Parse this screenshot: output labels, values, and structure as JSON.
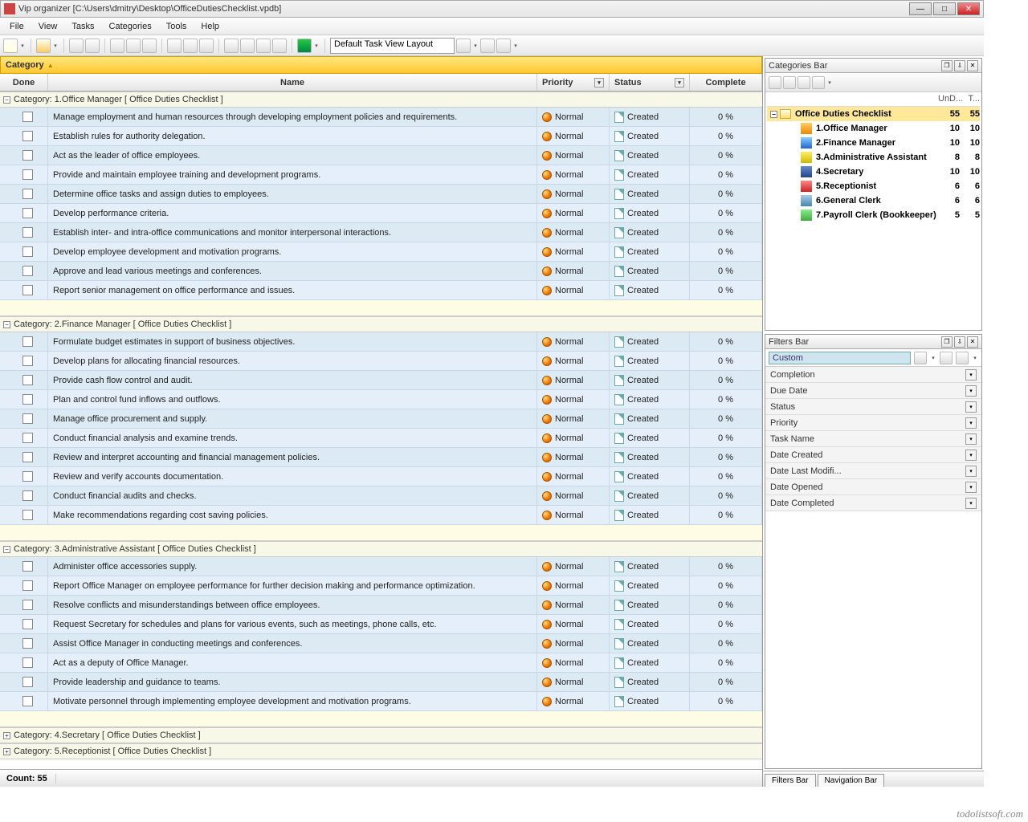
{
  "window": {
    "title": "Vip organizer [C:\\Users\\dmitry\\Desktop\\OfficeDutiesChecklist.vpdb]"
  },
  "menu": [
    "File",
    "View",
    "Tasks",
    "Categories",
    "Tools",
    "Help"
  ],
  "toolbar": {
    "layout_name": "Default Task View Layout"
  },
  "category_bar": {
    "label": "Category"
  },
  "grid": {
    "columns": {
      "done": "Done",
      "name": "Name",
      "priority": "Priority",
      "status": "Status",
      "complete": "Complete"
    },
    "groups": [
      {
        "title": "Category: 1.Office Manager   [ Office Duties Checklist ]",
        "expanded": true,
        "rows": [
          "Manage employment and human resources through developing employment policies and requirements.",
          "Establish rules for authority delegation.",
          "Act as the leader of office employees.",
          "Provide and maintain employee training and development programs.",
          "Determine office tasks and assign duties to employees.",
          "Develop performance criteria.",
          "Establish inter- and intra-office communications and monitor interpersonal interactions.",
          "Develop employee development and motivation programs.",
          "Approve and lead various meetings and conferences.",
          "Report senior management on office performance and issues."
        ]
      },
      {
        "title": "Category: 2.Finance Manager   [ Office Duties Checklist ]",
        "expanded": true,
        "rows": [
          "Formulate budget estimates in support of business objectives.",
          "Develop plans for allocating financial resources.",
          "Provide cash flow control and audit.",
          "Plan and control fund inflows and outflows.",
          "Manage office procurement and supply.",
          "Conduct financial analysis and examine trends.",
          "Review and interpret accounting and financial management policies.",
          "Review and verify accounts documentation.",
          "Conduct financial audits and checks.",
          "Make recommendations regarding cost saving policies."
        ]
      },
      {
        "title": "Category: 3.Administrative Assistant   [ Office Duties Checklist ]",
        "expanded": true,
        "rows": [
          "Administer office accessories supply.",
          "Report Office Manager on employee performance for further decision making and performance optimization.",
          "Resolve conflicts and misunderstandings between office employees.",
          "Request Secretary for schedules and plans for various events, such as meetings, phone calls, etc.",
          "Assist Office Manager in conducting meetings and conferences.",
          "Act as a deputy of Office Manager.",
          "Provide leadership and guidance to teams.",
          "Motivate personnel through implementing employee development and motivation programs."
        ]
      },
      {
        "title": "Category: 4.Secretary   [ Office Duties Checklist ]",
        "expanded": false,
        "rows": []
      },
      {
        "title": "Category: 5.Receptionist   [ Office Duties Checklist ]",
        "expanded": false,
        "rows": []
      }
    ],
    "priority": "Normal",
    "status": "Created",
    "complete": "0 %",
    "footer": {
      "count_label": "Count:",
      "count_value": "55"
    }
  },
  "categories_panel": {
    "title": "Categories Bar",
    "header_cols": {
      "c1": "UnD...",
      "c2": "T..."
    },
    "root": {
      "name": "Office Duties Checklist",
      "n1": "55",
      "n2": "55"
    },
    "items": [
      {
        "name": "1.Office Manager",
        "n1": "10",
        "n2": "10",
        "cls": "ci1"
      },
      {
        "name": "2.Finance Manager",
        "n1": "10",
        "n2": "10",
        "cls": "ci2"
      },
      {
        "name": "3.Administrative Assistant",
        "n1": "8",
        "n2": "8",
        "cls": "ci3"
      },
      {
        "name": "4.Secretary",
        "n1": "10",
        "n2": "10",
        "cls": "ci4"
      },
      {
        "name": "5.Receptionist",
        "n1": "6",
        "n2": "6",
        "cls": "ci5"
      },
      {
        "name": "6.General Clerk",
        "n1": "6",
        "n2": "6",
        "cls": "ci6"
      },
      {
        "name": "7.Payroll Clerk (Bookkeeper)",
        "n1": "5",
        "n2": "5",
        "cls": "ci7"
      }
    ]
  },
  "filters_panel": {
    "title": "Filters Bar",
    "preset": "Custom",
    "rows": [
      "Completion",
      "Due Date",
      "Status",
      "Priority",
      "Task Name",
      "Date Created",
      "Date Last Modifi...",
      "Date Opened",
      "Date Completed"
    ]
  },
  "bottom_tabs": [
    "Filters Bar",
    "Navigation Bar"
  ],
  "watermark": "todolistsoft.com"
}
